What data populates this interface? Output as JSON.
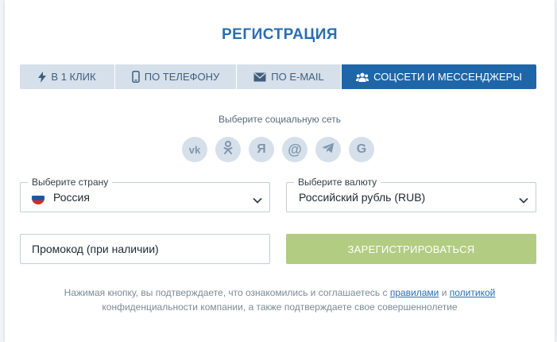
{
  "title": "РЕГИСТРАЦИЯ",
  "tabs": [
    {
      "label": "В 1 КЛИК",
      "icon": "lightning-icon",
      "active": false
    },
    {
      "label": "ПО ТЕЛЕФОНУ",
      "icon": "phone-icon",
      "active": false
    },
    {
      "label": "ПО E-MAIL",
      "icon": "envelope-icon",
      "active": false
    },
    {
      "label": "СОЦСЕТИ И МЕССЕНДЖЕРЫ",
      "icon": "users-icon",
      "active": true
    }
  ],
  "social": {
    "prompt": "Выберите социальную сеть",
    "networks": [
      {
        "name": "vk-icon",
        "glyph": "vk"
      },
      {
        "name": "odnoklassniki-icon",
        "glyph": ""
      },
      {
        "name": "yandex-icon",
        "glyph": "Я"
      },
      {
        "name": "mailru-icon",
        "glyph": "@"
      },
      {
        "name": "telegram-icon",
        "glyph": ""
      },
      {
        "name": "google-icon",
        "glyph": "G"
      }
    ]
  },
  "country": {
    "label": "Выберите страну",
    "value": "Россия"
  },
  "currency": {
    "label": "Выберите валюту",
    "value": "Российский рубль (RUB)"
  },
  "promo": {
    "placeholder": "Промокод (при наличии)"
  },
  "submit": {
    "label": "ЗАРЕГИСТРИРОВАТЬСЯ"
  },
  "footer": {
    "text_before": "Нажимая кнопку, вы подтверждаете, что ознакомились и соглашаетесь с ",
    "link_rules": "правилами",
    "conj": " и ",
    "link_policy": "политикой",
    "text_after": "конфиденциальности компании, а также подтверждаете свое совершеннолетие"
  },
  "colors": {
    "accent": "#2a6db2",
    "tab_active": "#1f66a8",
    "tab_inactive": "#d6e0ea",
    "submit_disabled": "#b2cc82"
  }
}
